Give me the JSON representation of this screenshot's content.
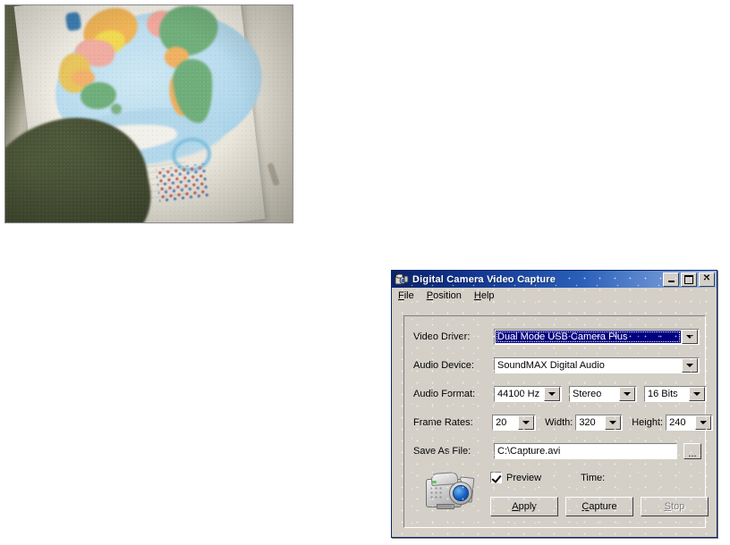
{
  "photo": {
    "alt_description": "Blurry low-light camera capture of an open atlas page showing a Pacific-centred world map, with a dark green shoulder at lower left and a pale door at right",
    "subject": "world-map-atlas-page"
  },
  "window": {
    "title": "Digital Camera Video Capture",
    "icon": "camcorder-app-icon",
    "buttons": {
      "minimize": "minimize-icon",
      "maximize": "maximize-icon",
      "close": "close-icon"
    },
    "menu": [
      {
        "label": "File",
        "accel": "F"
      },
      {
        "label": "Position",
        "accel": "P"
      },
      {
        "label": "Help",
        "accel": "H"
      }
    ],
    "form": {
      "video_driver": {
        "label": "Video Driver:",
        "value": "Dual Mode USB Camera Plus",
        "focused": true
      },
      "audio_device": {
        "label": "Audio Device:",
        "value": "SoundMAX Digital Audio"
      },
      "audio_format": {
        "label": "Audio Format:",
        "sample_rate": "44100 Hz",
        "channels": "Stereo",
        "bit_depth": "16 Bits"
      },
      "frame_rates": {
        "label": "Frame Rates:",
        "value": "20"
      },
      "width": {
        "label": "Width:",
        "value": "320"
      },
      "height": {
        "label": "Height:",
        "value": "240"
      },
      "save_as_file": {
        "label": "Save As File:",
        "value": "C:\\Capture.avi",
        "browse_label": "..."
      },
      "preview": {
        "label": "Preview",
        "checked": true
      },
      "time": {
        "label": "Time:",
        "value": ""
      },
      "device_icon": "camcorder-icon"
    },
    "actions": [
      {
        "name": "apply",
        "label": "Apply",
        "accel": "A",
        "enabled": true
      },
      {
        "name": "capture",
        "label": "Capture",
        "accel": "C",
        "enabled": true
      },
      {
        "name": "stop",
        "label": "Stop",
        "accel": "S",
        "enabled": false
      }
    ]
  },
  "colors": {
    "title_active_left": "#0a246a",
    "title_active_right": "#a6c0e8",
    "face": "#d4d0c8",
    "selection": "#000080",
    "disabled_text": "#808080"
  }
}
